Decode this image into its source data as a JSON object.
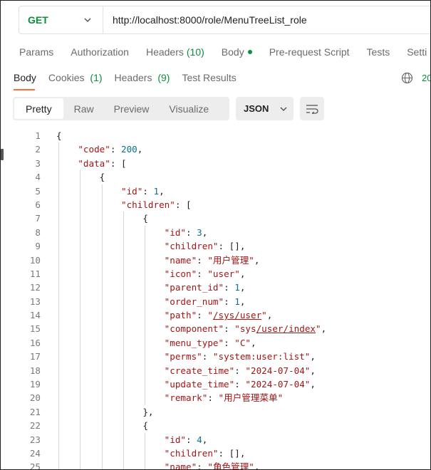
{
  "request": {
    "method": "GET",
    "url": "http://localhost:8000/role/MenuTreeList_role",
    "tabs": [
      {
        "label": "Params",
        "count": ""
      },
      {
        "label": "Authorization",
        "count": ""
      },
      {
        "label": "Headers",
        "count": "(10)"
      },
      {
        "label": "Body",
        "count": ""
      },
      {
        "label": "Pre-request Script",
        "count": ""
      },
      {
        "label": "Tests",
        "count": ""
      },
      {
        "label": "Setti",
        "count": ""
      }
    ]
  },
  "response": {
    "tabs": [
      {
        "label": "Body",
        "count": ""
      },
      {
        "label": "Cookies",
        "count": "(1)"
      },
      {
        "label": "Headers",
        "count": "(9)"
      },
      {
        "label": "Test Results",
        "count": ""
      }
    ],
    "status_partial": "20",
    "views": [
      "Pretty",
      "Raw",
      "Preview",
      "Visualize"
    ],
    "format": "JSON"
  },
  "colors": {
    "accent_orange": "#ff6c37",
    "ok_green": "#0b8d3b",
    "json_key": "#a31515",
    "json_number": "#0b6f8d"
  },
  "code": {
    "lines": [
      {
        "n": "1",
        "indent": 0,
        "parts": [
          [
            "p",
            "{"
          ]
        ]
      },
      {
        "n": "2",
        "indent": 1,
        "parts": [
          [
            "k",
            "\"code\""
          ],
          [
            "p",
            ": "
          ],
          [
            "n",
            "200"
          ],
          [
            "p",
            ","
          ]
        ]
      },
      {
        "n": "3",
        "indent": 1,
        "parts": [
          [
            "k",
            "\"data\""
          ],
          [
            "p",
            ": ["
          ]
        ]
      },
      {
        "n": "4",
        "indent": 2,
        "parts": [
          [
            "p",
            "{"
          ]
        ]
      },
      {
        "n": "5",
        "indent": 3,
        "parts": [
          [
            "k",
            "\"id\""
          ],
          [
            "p",
            ": "
          ],
          [
            "n",
            "1"
          ],
          [
            "p",
            ","
          ]
        ]
      },
      {
        "n": "6",
        "indent": 3,
        "parts": [
          [
            "k",
            "\"children\""
          ],
          [
            "p",
            ": ["
          ]
        ]
      },
      {
        "n": "7",
        "indent": 4,
        "parts": [
          [
            "p",
            "{"
          ]
        ]
      },
      {
        "n": "8",
        "indent": 5,
        "parts": [
          [
            "k",
            "\"id\""
          ],
          [
            "p",
            ": "
          ],
          [
            "n",
            "3"
          ],
          [
            "p",
            ","
          ]
        ]
      },
      {
        "n": "9",
        "indent": 5,
        "parts": [
          [
            "k",
            "\"children\""
          ],
          [
            "p",
            ": [],"
          ]
        ]
      },
      {
        "n": "10",
        "indent": 5,
        "parts": [
          [
            "k",
            "\"name\""
          ],
          [
            "p",
            ": "
          ],
          [
            "s",
            "\"用户管理\""
          ],
          [
            "p",
            ","
          ]
        ]
      },
      {
        "n": "11",
        "indent": 5,
        "parts": [
          [
            "k",
            "\"icon\""
          ],
          [
            "p",
            ": "
          ],
          [
            "s",
            "\"user\""
          ],
          [
            "p",
            ","
          ]
        ]
      },
      {
        "n": "12",
        "indent": 5,
        "parts": [
          [
            "k",
            "\"parent_id\""
          ],
          [
            "p",
            ": "
          ],
          [
            "n",
            "1"
          ],
          [
            "p",
            ","
          ]
        ]
      },
      {
        "n": "13",
        "indent": 5,
        "parts": [
          [
            "k",
            "\"order_num\""
          ],
          [
            "p",
            ": "
          ],
          [
            "n",
            "1"
          ],
          [
            "p",
            ","
          ]
        ]
      },
      {
        "n": "14",
        "indent": 5,
        "parts": [
          [
            "k",
            "\"path\""
          ],
          [
            "p",
            ": "
          ],
          [
            "s",
            "\""
          ],
          [
            "sl",
            "/sys/user"
          ],
          [
            "s",
            "\""
          ],
          [
            "p",
            ","
          ]
        ]
      },
      {
        "n": "15",
        "indent": 5,
        "parts": [
          [
            "k",
            "\"component\""
          ],
          [
            "p",
            ": "
          ],
          [
            "s",
            "\"sys"
          ],
          [
            "sl",
            "/user/index"
          ],
          [
            "s",
            "\""
          ],
          [
            "p",
            ","
          ]
        ]
      },
      {
        "n": "16",
        "indent": 5,
        "parts": [
          [
            "k",
            "\"menu_type\""
          ],
          [
            "p",
            ": "
          ],
          [
            "s",
            "\"C\""
          ],
          [
            "p",
            ","
          ]
        ]
      },
      {
        "n": "17",
        "indent": 5,
        "parts": [
          [
            "k",
            "\"perms\""
          ],
          [
            "p",
            ": "
          ],
          [
            "s",
            "\"system:user:list\""
          ],
          [
            "p",
            ","
          ]
        ]
      },
      {
        "n": "18",
        "indent": 5,
        "parts": [
          [
            "k",
            "\"create_time\""
          ],
          [
            "p",
            ": "
          ],
          [
            "s",
            "\"2024-07-04\""
          ],
          [
            "p",
            ","
          ]
        ]
      },
      {
        "n": "19",
        "indent": 5,
        "parts": [
          [
            "k",
            "\"update_time\""
          ],
          [
            "p",
            ": "
          ],
          [
            "s",
            "\"2024-07-04\""
          ],
          [
            "p",
            ","
          ]
        ]
      },
      {
        "n": "20",
        "indent": 5,
        "parts": [
          [
            "k",
            "\"remark\""
          ],
          [
            "p",
            ": "
          ],
          [
            "s",
            "\"用户管理菜单\""
          ]
        ]
      },
      {
        "n": "21",
        "indent": 4,
        "parts": [
          [
            "p",
            "},"
          ]
        ]
      },
      {
        "n": "22",
        "indent": 4,
        "parts": [
          [
            "p",
            "{"
          ]
        ]
      },
      {
        "n": "23",
        "indent": 5,
        "parts": [
          [
            "k",
            "\"id\""
          ],
          [
            "p",
            ": "
          ],
          [
            "n",
            "4"
          ],
          [
            "p",
            ","
          ]
        ]
      },
      {
        "n": "24",
        "indent": 5,
        "parts": [
          [
            "k",
            "\"children\""
          ],
          [
            "p",
            ": [],"
          ]
        ]
      },
      {
        "n": "25",
        "indent": 5,
        "parts": [
          [
            "k",
            "\"name\""
          ],
          [
            "p",
            ": "
          ],
          [
            "s",
            "\"角色管理\""
          ],
          [
            "p",
            ","
          ]
        ]
      }
    ]
  }
}
